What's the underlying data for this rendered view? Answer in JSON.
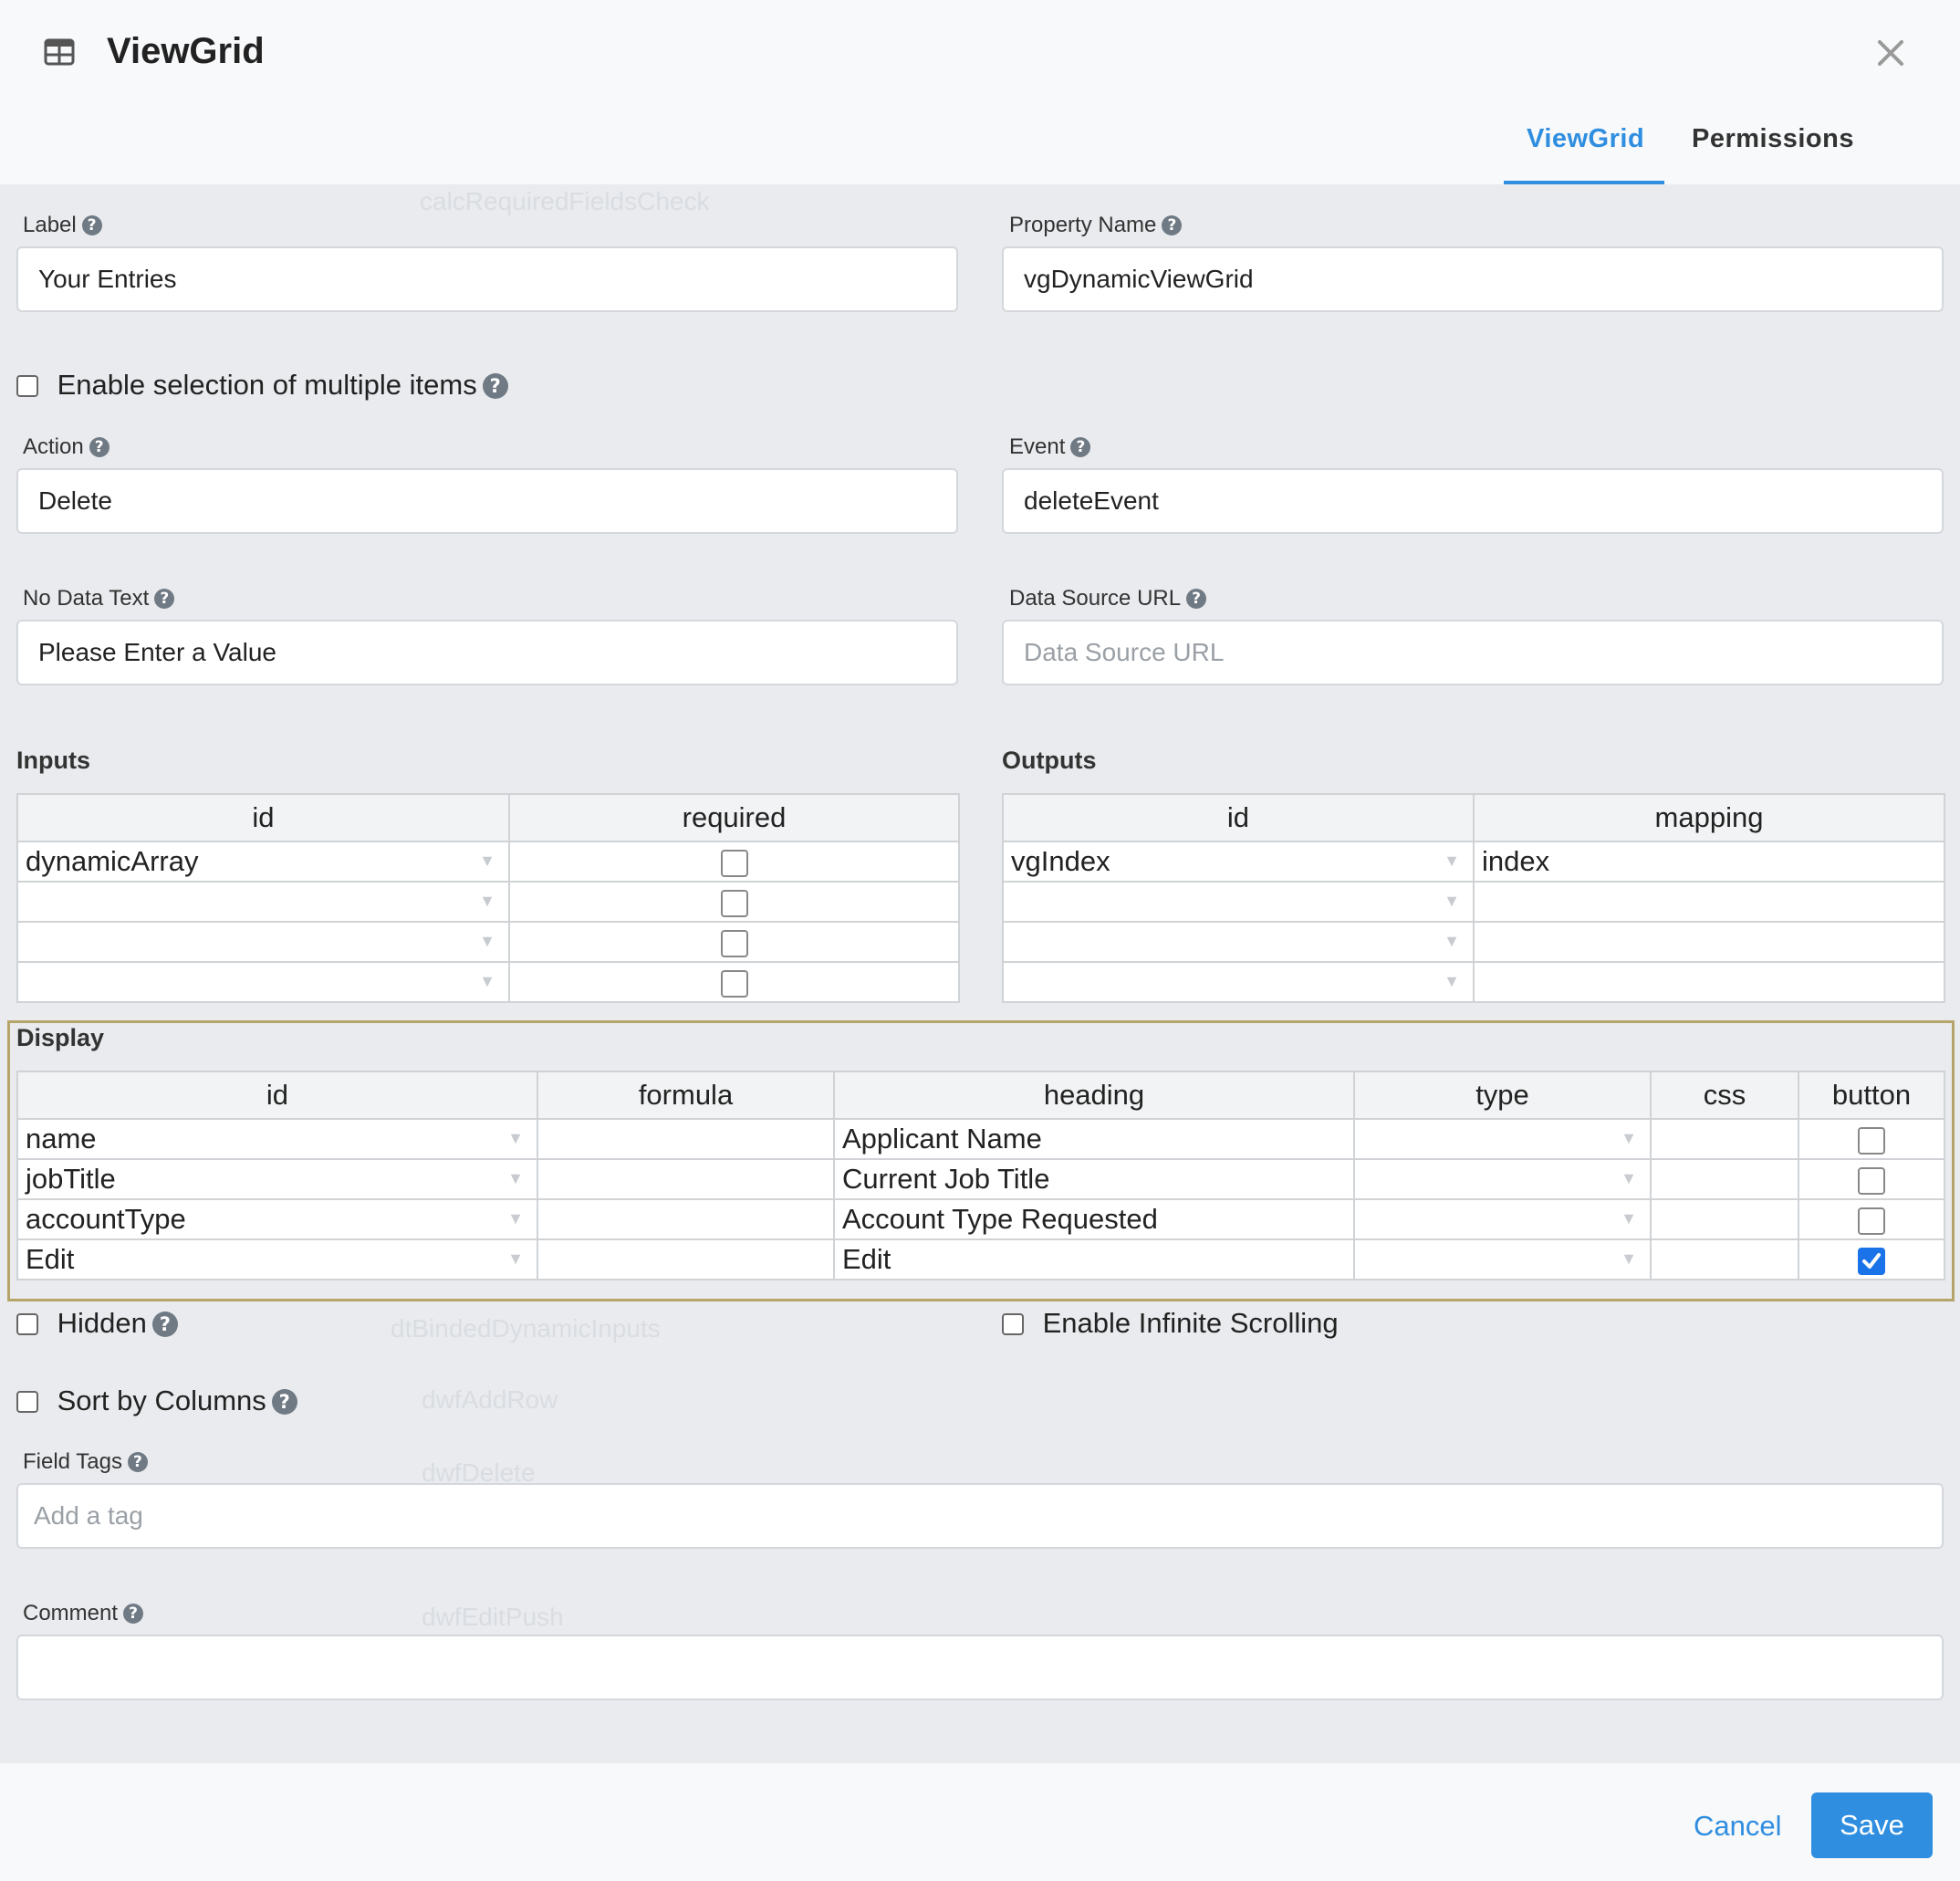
{
  "dialog": {
    "title": "ViewGrid",
    "tabs": [
      {
        "label": "ViewGrid",
        "active": true
      },
      {
        "label": "Permissions",
        "active": false
      }
    ]
  },
  "background_ghost": [
    "calcRequiredFieldsCheck",
    "dtBindedDynamicInputs",
    "dwfAddRow",
    "dwfDelete",
    "dwfEditPush"
  ],
  "form": {
    "label": {
      "label": "Label",
      "value": "Your Entries"
    },
    "property_name": {
      "label": "Property Name",
      "value": "vgDynamicViewGrid"
    },
    "multi_select": {
      "label": "Enable selection of multiple items",
      "checked": false
    },
    "action": {
      "label": "Action",
      "value": "Delete"
    },
    "event": {
      "label": "Event",
      "value": "deleteEvent"
    },
    "no_data_text": {
      "label": "No Data Text",
      "value": "Please Enter a Value"
    },
    "data_source_url": {
      "label": "Data Source URL",
      "value": "",
      "placeholder": "Data Source URL"
    },
    "hidden": {
      "label": "Hidden",
      "checked": false
    },
    "infinite_scrolling": {
      "label": "Enable Infinite Scrolling",
      "checked": false
    },
    "sort_by_columns": {
      "label": "Sort by Columns",
      "checked": false
    },
    "field_tags": {
      "label": "Field Tags",
      "placeholder": "Add a tag"
    },
    "comment": {
      "label": "Comment",
      "value": ""
    }
  },
  "inputs": {
    "title": "Inputs",
    "columns": [
      "id",
      "required"
    ],
    "rows": [
      {
        "id": "dynamicArray",
        "required": false
      },
      {
        "id": "",
        "required": false
      },
      {
        "id": "",
        "required": false
      },
      {
        "id": "",
        "required": false
      }
    ]
  },
  "outputs": {
    "title": "Outputs",
    "columns": [
      "id",
      "mapping"
    ],
    "rows": [
      {
        "id": "vgIndex",
        "mapping": "index"
      },
      {
        "id": "",
        "mapping": ""
      },
      {
        "id": "",
        "mapping": ""
      },
      {
        "id": "",
        "mapping": ""
      }
    ]
  },
  "display": {
    "title": "Display",
    "columns": [
      "id",
      "formula",
      "heading",
      "type",
      "css",
      "button"
    ],
    "rows": [
      {
        "id": "name",
        "formula": "",
        "heading": "Applicant Name",
        "type": "",
        "css": "",
        "button": false
      },
      {
        "id": "jobTitle",
        "formula": "",
        "heading": "Current Job Title",
        "type": "",
        "css": "",
        "button": false
      },
      {
        "id": "accountType",
        "formula": "",
        "heading": "Account Type Requested",
        "type": "",
        "css": "",
        "button": false
      },
      {
        "id": "Edit",
        "formula": "",
        "heading": "Edit",
        "type": "",
        "css": "",
        "button": true
      }
    ]
  },
  "footer": {
    "cancel_label": "Cancel",
    "save_label": "Save"
  },
  "colors": {
    "accent": "#2f8ee0",
    "highlight_frame": "#b5a56a"
  }
}
